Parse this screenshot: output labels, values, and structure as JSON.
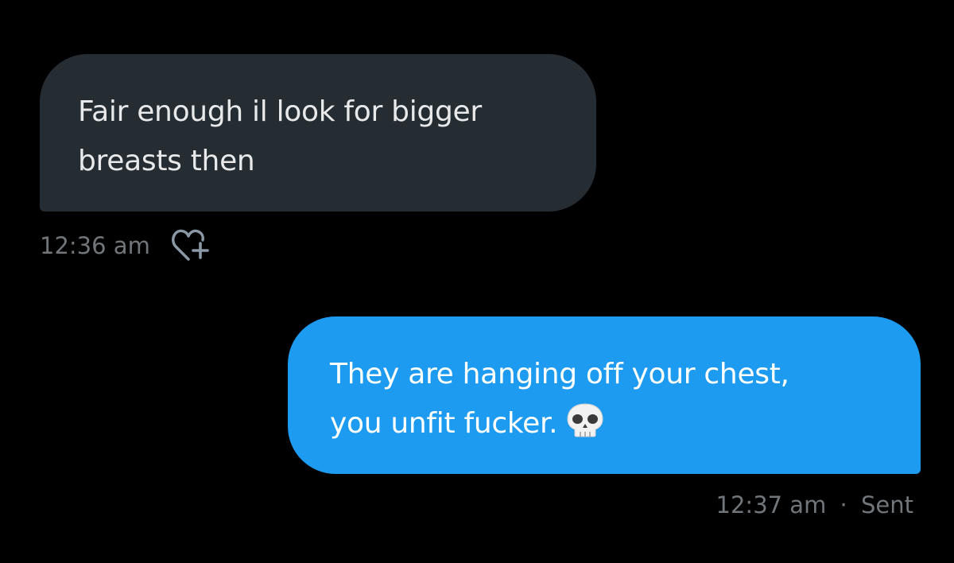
{
  "conversation": {
    "incoming_message": {
      "lines": [
        "Fair enough il look for bigger",
        "breasts then"
      ],
      "timestamp": "12:36 am",
      "react_icon": "heart-plus-icon"
    },
    "outgoing_message": {
      "lines": [
        "They are hanging off your chest,",
        "you unfit fucker."
      ],
      "emoji_icon": "skull-emoji",
      "timestamp": "12:37 am",
      "separator": "·",
      "status": "Sent"
    }
  },
  "colors": {
    "background": "#000000",
    "incoming_bubble": "#252d33",
    "outgoing_bubble": "#1d9bf0",
    "meta_text": "#71767b"
  }
}
